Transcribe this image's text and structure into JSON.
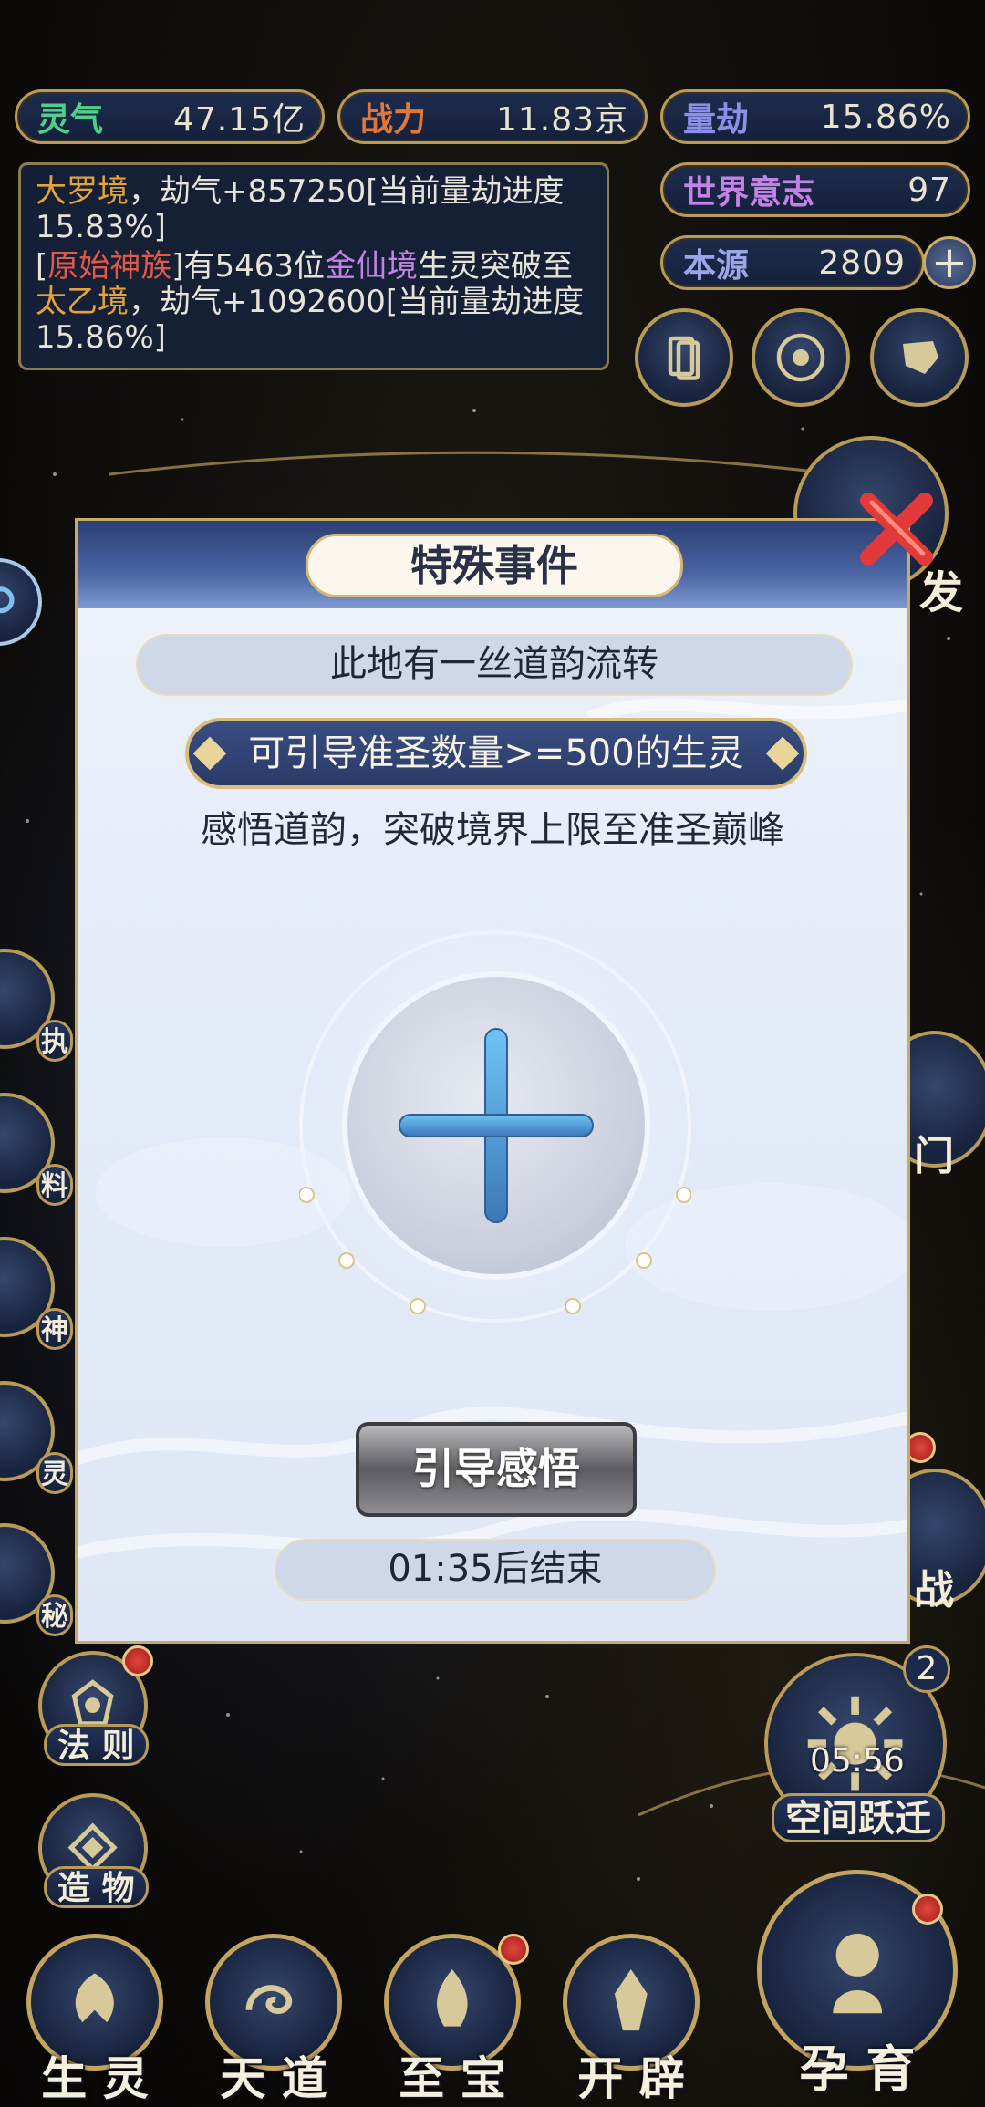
{
  "resources": {
    "lingqi": {
      "label": "灵气",
      "value": "47.15亿"
    },
    "zhanli": {
      "label": "战力",
      "value": "11.83京"
    },
    "liangjie": {
      "label": "量劫",
      "value": "15.86%"
    },
    "shijie": {
      "label": "世界意志",
      "value": "97"
    },
    "benyuan": {
      "label": "本源",
      "value": "2809"
    }
  },
  "log": {
    "line1_a": "大罗境",
    "line1_b": "，劫气+857250[当前量劫进度15.83%]",
    "line2_a": "[",
    "line2_b": "原始神族",
    "line2_c": "]有5463位",
    "line2_d": "金仙境",
    "line2_e": "生灵突破至",
    "line2_f": "太乙境",
    "line2_g": "，劫气+1092600[当前量劫进度15.86%]"
  },
  "side": {
    "fa": "发",
    "men": "门",
    "zhan": "战",
    "faze": "法 则",
    "zaowu": "造 物",
    "kongjian": "空间跃迁",
    "timer": "05:56",
    "badge": "2"
  },
  "left_partial": [
    "执",
    "料",
    "神",
    "灵",
    "秘"
  ],
  "nav": {
    "shengling": "生 灵",
    "tiandao": "天 道",
    "zhibao": "至 宝",
    "kaipi": "开 辟",
    "yunyu": "孕 育"
  },
  "modal": {
    "title": "特殊事件",
    "subtitle": "此地有一丝道韵流转",
    "requirement": "可引导准圣数量>=500的生灵",
    "description": "感悟道韵，突破境界上限至准圣巅峰",
    "action": "引导感悟",
    "countdown": "01:35后结束"
  },
  "colors": {
    "accent_gold": "#c8aa68",
    "panel_blue": "#1d2c4d",
    "highlight_gold": "#e5a43a",
    "highlight_red": "#e05a4a",
    "highlight_purple": "#c582e6"
  }
}
